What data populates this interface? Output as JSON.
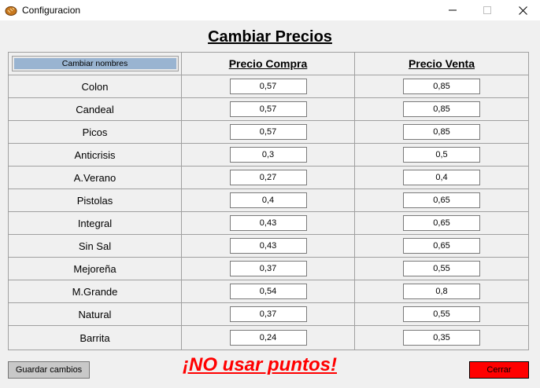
{
  "window": {
    "title": "Configuracion"
  },
  "heading": "Cambiar Precios",
  "table": {
    "rename_button": "Cambiar nombres",
    "columns": [
      "Precio Compra",
      "Precio Venta"
    ],
    "rows": [
      {
        "name": "Colon",
        "compra": "0,57",
        "venta": "0,85"
      },
      {
        "name": "Candeal",
        "compra": "0,57",
        "venta": "0,85"
      },
      {
        "name": "Picos",
        "compra": "0,57",
        "venta": "0,85"
      },
      {
        "name": "Anticrisis",
        "compra": "0,3",
        "venta": "0,5"
      },
      {
        "name": "A.Verano",
        "compra": "0,27",
        "venta": "0,4"
      },
      {
        "name": "Pistolas",
        "compra": "0,4",
        "venta": "0,65"
      },
      {
        "name": "Integral",
        "compra": "0,43",
        "venta": "0,65"
      },
      {
        "name": "Sin Sal",
        "compra": "0,43",
        "venta": "0,65"
      },
      {
        "name": "Mejoreña",
        "compra": "0,37",
        "venta": "0,55"
      },
      {
        "name": "M.Grande",
        "compra": "0,54",
        "venta": "0,8"
      },
      {
        "name": "Natural",
        "compra": "0,37",
        "venta": "0,55"
      },
      {
        "name": "Barrita",
        "compra": "0,24",
        "venta": "0,35"
      }
    ]
  },
  "footer": {
    "save_label": "Guardar cambios",
    "warning": "¡NO usar puntos!",
    "close_label": "Cerrar"
  },
  "colors": {
    "close_button": "#ff0000",
    "warning_text": "#ff0000",
    "rename_button": "#99b4d1"
  },
  "icons": {
    "app": "bread-icon",
    "minimize": "minimize-icon",
    "maximize": "maximize-icon",
    "close": "close-icon"
  }
}
